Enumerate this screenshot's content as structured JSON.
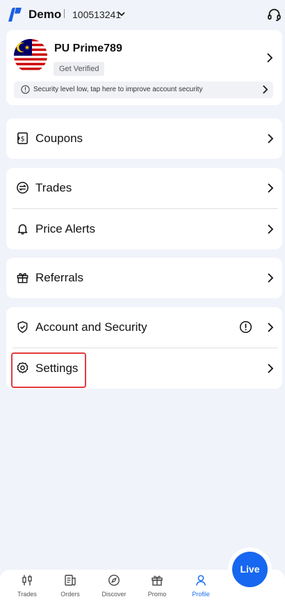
{
  "header": {
    "account_type": "Demo",
    "account_number": "100513241"
  },
  "profile": {
    "username": "PU Prime789",
    "verify_label": "Get Verified",
    "security_notice": "Security level low, tap here to improve account security"
  },
  "menu": {
    "coupons": "Coupons",
    "trades": "Trades",
    "price_alerts": "Price Alerts",
    "referrals": "Referrals",
    "account_security": "Account and Security",
    "settings": "Settings"
  },
  "live_button": "Live",
  "bottom_nav": {
    "trades": "Trades",
    "orders": "Orders",
    "discover": "Discover",
    "promo": "Promo",
    "profile": "Profile"
  },
  "colors": {
    "accent": "#1767f0",
    "active_nav": "#1f6ff0",
    "highlight": "#e23b3b",
    "background": "#f1f3fa"
  }
}
